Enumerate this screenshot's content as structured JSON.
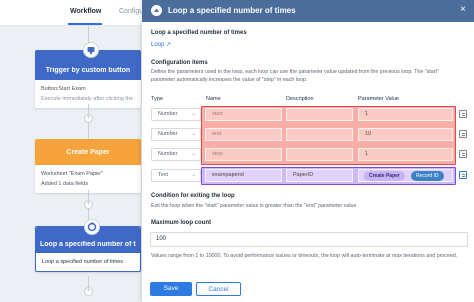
{
  "tabs": {
    "workflow": "Workflow",
    "config": "Configurations"
  },
  "nodes": {
    "trigger": {
      "title": "Trigger by custom button",
      "button_line": "Button:Start Exam",
      "description": "Execute immediately after clicking the button"
    },
    "create_paper": {
      "title": "Create Paper",
      "worksheet_line": "Worksheet \"Exam Paper\"",
      "added_fields": "Added 1 data fields"
    },
    "loop": {
      "title": "Loop a specified number of times",
      "body": "Loop a specified number of times"
    }
  },
  "panel": {
    "title": "Loop a specified number of times",
    "heading": "Loop a specified number of times",
    "link": "Loop",
    "config_title": "Configuration items",
    "config_desc_1": "Define the parameters used in the loop, each loop can use the parameter value updated from the previous loop. The \"start\"",
    "config_desc_2": "parameter automatically increases the value of \"step\" in each loop.",
    "columns": {
      "type": "Type",
      "name": "Name",
      "description": "Description",
      "value": "Parameter Value"
    },
    "params": [
      {
        "type": "Number",
        "name": "start",
        "description": "",
        "value": "1"
      },
      {
        "type": "Number",
        "name": "end",
        "description": "",
        "value": "10"
      },
      {
        "type": "Number",
        "name": "step",
        "description": "",
        "value": "1"
      },
      {
        "type": "Text",
        "name": "exampaperid",
        "description": "PaperID",
        "value_chip_1": "Create Paper",
        "value_chip_2": "Record ID"
      }
    ],
    "exit_title": "Condition for exiting the loop",
    "exit_desc": "Exit the loop when the \"start\" parameter value is greater than the \"end\" parameter value",
    "max_title": "Maximum loop count",
    "max_value": "100",
    "max_desc": "Values range from 1 to 10000. To avoid performance issues or timeouts, the loop will auto-terminate at max iterations and proceed.",
    "save_label": "Save",
    "cancel_label": "Cancel"
  },
  "colors": {
    "accent": "#2d7be0",
    "trigger_header": "#3f69c6",
    "create_header": "#f5a33a",
    "panel_header": "#4b6d9b",
    "highlight_red": "#f26b5e",
    "highlight_purple": "#a380f0"
  }
}
